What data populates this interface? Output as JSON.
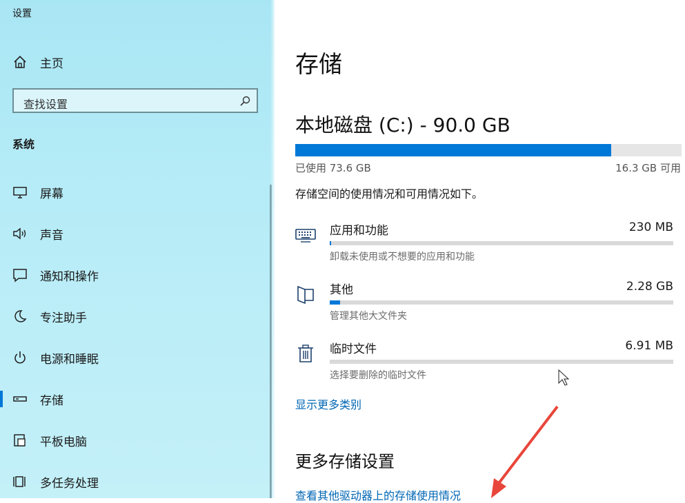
{
  "window": {
    "title": "设置"
  },
  "sidebar": {
    "home_label": "主页",
    "search_placeholder": "查找设置",
    "section_label": "系统",
    "items": [
      {
        "label": "屏幕",
        "icon": "monitor-icon"
      },
      {
        "label": "声音",
        "icon": "speaker-icon"
      },
      {
        "label": "通知和操作",
        "icon": "notification-icon"
      },
      {
        "label": "专注助手",
        "icon": "moon-icon"
      },
      {
        "label": "电源和睡眠",
        "icon": "power-icon"
      },
      {
        "label": "存储",
        "icon": "storage-icon",
        "active": true
      },
      {
        "label": "平板电脑",
        "icon": "tablet-icon"
      },
      {
        "label": "多任务处理",
        "icon": "multitask-icon"
      }
    ]
  },
  "main": {
    "title": "存储",
    "drive": {
      "title": "本地磁盘 (C:) - 90.0 GB",
      "used": "已使用 73.6 GB",
      "available": "16.3 GB 可用",
      "used_fraction": 0.818
    },
    "description": "存储空间的使用情况和可用情况如下。",
    "categories": [
      {
        "name": "应用和功能",
        "size": "230 MB",
        "sub": "卸载未使用或不想要的应用和功能",
        "fraction": 0.004,
        "icon": "keyboard-icon"
      },
      {
        "name": "其他",
        "size": "2.28 GB",
        "sub": "管理其他大文件夹",
        "fraction": 0.03,
        "icon": "folder-icon"
      },
      {
        "name": "临时文件",
        "size": "6.91 MB",
        "sub": "选择要删除的临时文件",
        "fraction": 0.0,
        "icon": "trash-icon"
      }
    ],
    "show_more": "显示更多类别",
    "more_settings_title": "更多存储设置",
    "other_drives_link": "查看其他驱动器上的存储使用情况"
  },
  "colors": {
    "accent": "#0078d7",
    "link": "#0066b4",
    "sidebar_bg": "#b6ecf7",
    "annotation_arrow": "#e8463a"
  }
}
